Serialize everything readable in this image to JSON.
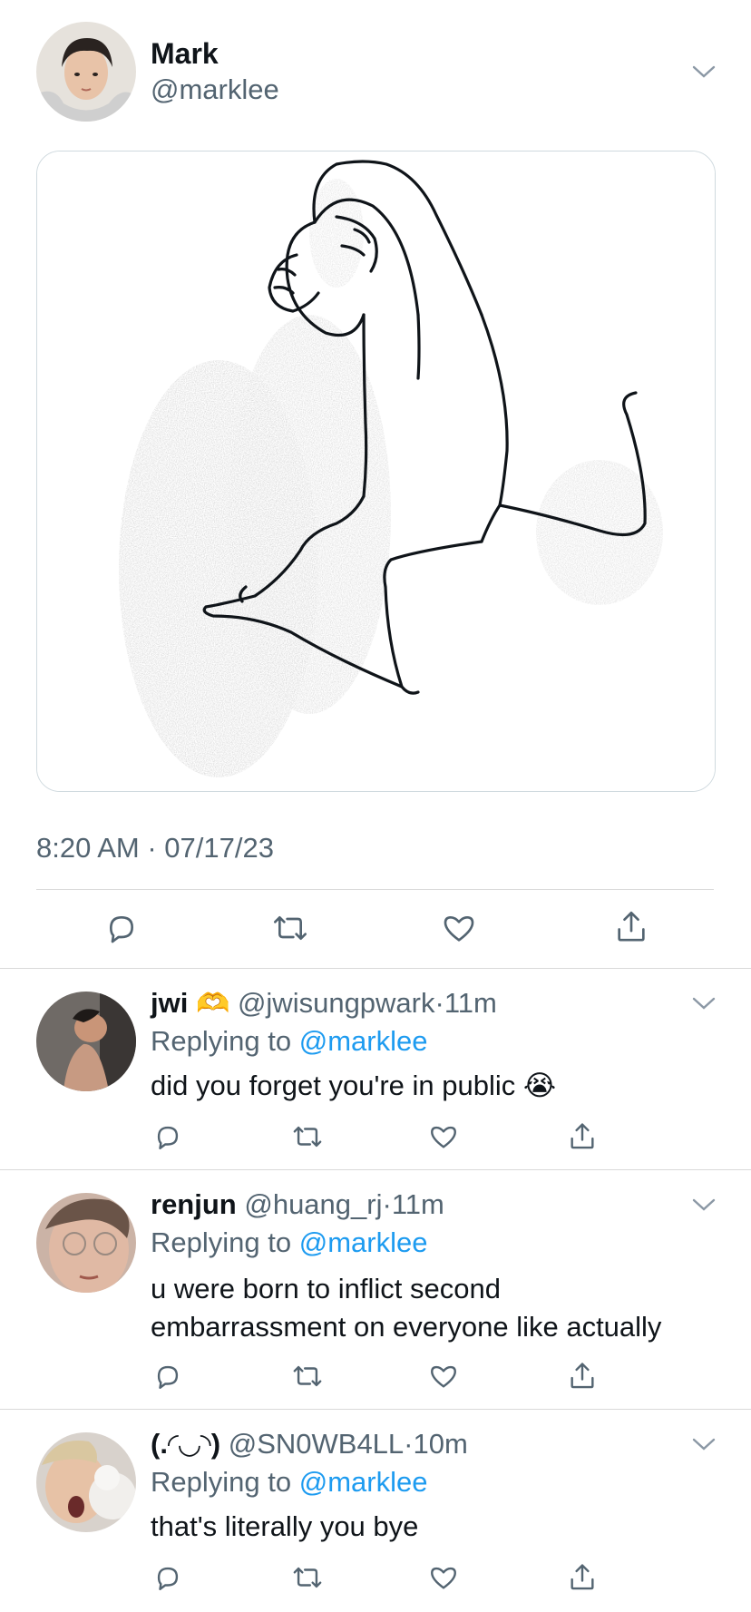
{
  "tweet": {
    "author_name": "Mark",
    "author_handle": "@marklee",
    "timestamp": "8:20 AM · 07/17/23"
  },
  "replies": [
    {
      "name": "jwi",
      "badge_emoji": "🫶",
      "handle": "@jwisungpwark",
      "time": "11m",
      "replying_prefix": "Replying to",
      "replying_to": "@marklee",
      "text": "did you forget you're in public",
      "text_emoji": "😭"
    },
    {
      "name": "renjun",
      "handle": "@huang_rj",
      "time": "11m",
      "replying_prefix": "Replying to",
      "replying_to": "@marklee",
      "text_line1": "u were born to inflict second",
      "text_line2": "embarrassment on everyone like actually"
    },
    {
      "name": "(.◜◡◝)",
      "handle": "@SN0WB4LL",
      "time": "10m",
      "replying_prefix": "Replying to",
      "replying_to": "@marklee",
      "text": "that's literally you bye"
    }
  ],
  "separator": "·",
  "colors": {
    "text": "#0f1419",
    "muted": "#536471",
    "link": "#1d9bf0",
    "divider": "#d9d9d9"
  },
  "icons": [
    "chevron-down-icon",
    "reply-icon",
    "retweet-icon",
    "like-icon",
    "share-icon"
  ]
}
